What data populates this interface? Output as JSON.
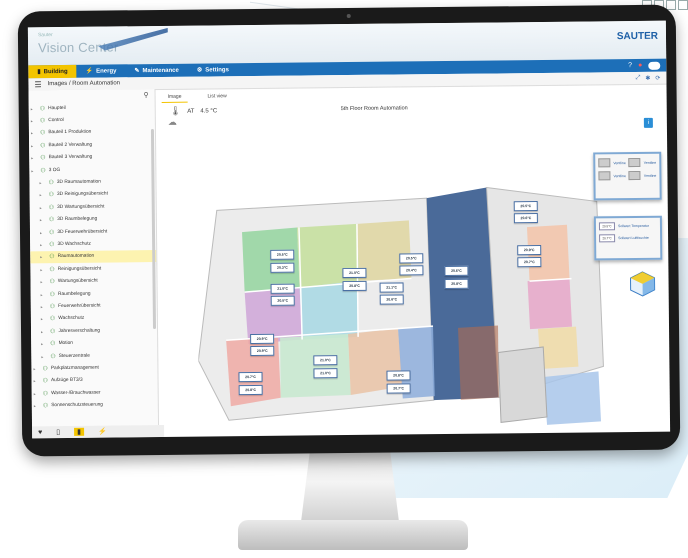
{
  "app": {
    "logo_small": "Sauter",
    "logo": "Vision Center",
    "brand": "SAUTER"
  },
  "tabs": [
    {
      "label": "Building",
      "icon": "building-icon",
      "active": true
    },
    {
      "label": "Energy",
      "icon": "lightning-icon",
      "active": false
    },
    {
      "label": "Maintenance",
      "icon": "wrench-icon",
      "active": false
    },
    {
      "label": "Settings",
      "icon": "gear-icon",
      "active": false
    }
  ],
  "breadcrumb": "Images / Room Automation",
  "tree": [
    {
      "label": "Haupteil",
      "level": 1
    },
    {
      "label": "Control",
      "level": 1
    },
    {
      "label": "Bauteil 1 Produktion",
      "level": 1
    },
    {
      "label": "Bauteil 2 Verwaltung",
      "level": 1
    },
    {
      "label": "Bauteil 3 Verwaltung",
      "level": 1
    },
    {
      "label": "3 OG",
      "level": 1
    },
    {
      "label": "3D Raumautomation",
      "level": 2
    },
    {
      "label": "3D Reinigungsübersicht",
      "level": 2
    },
    {
      "label": "3D Wartungsübersicht",
      "level": 2
    },
    {
      "label": "3D Raumbelegung",
      "level": 2
    },
    {
      "label": "3D Feuerwehrübersicht",
      "level": 2
    },
    {
      "label": "3D Wachschutz",
      "level": 2
    },
    {
      "label": "Raumautomation",
      "level": 2,
      "selected": true
    },
    {
      "label": "Reinigungsübersicht",
      "level": 2
    },
    {
      "label": "Wartungsübersicht",
      "level": 2
    },
    {
      "label": "Raumbelegung",
      "level": 2
    },
    {
      "label": "Feuerwehrübersicht",
      "level": 2
    },
    {
      "label": "Wachschutz",
      "level": 2
    },
    {
      "label": "Jahresverschaltung",
      "level": 2
    },
    {
      "label": "Motion",
      "level": 2
    },
    {
      "label": "Steuerzentrale",
      "level": 2
    },
    {
      "label": "Parkplatzmanagement",
      "level": 1
    },
    {
      "label": "Aufzüge BT3/3",
      "level": 1
    },
    {
      "label": "Wasser-/Brauchwasser",
      "level": 1
    },
    {
      "label": "Sonnenschutzsteuerung",
      "level": 1
    }
  ],
  "main": {
    "tab_image": "Image",
    "tab_list": "List view",
    "temp_label": "AT",
    "temp_value": "4.5 °C",
    "plan_title": "5th Floor Room Automation"
  },
  "room_labels": [
    "20.5°C",
    "20.3°C",
    "21.0°C",
    "20.8°C",
    "20.5°C",
    "20.4°C",
    "21.0°C",
    "20.5°C",
    "21.1°C",
    "20.6°C",
    "20.9°C",
    "20.9°C",
    "20.7°C",
    "20.8°C",
    "21.0°C",
    "21.0°C",
    "20.8°C",
    "20.7°C",
    "20.6°C",
    "20.8°C",
    "20.5°C",
    "20.6°C",
    "20.9°C",
    "20.7°C"
  ],
  "legend1": [
    {
      "a": "Ventline",
      "b": "Ventline"
    },
    {
      "a": "Ventline",
      "b": "Ventline"
    }
  ],
  "legend2": [
    {
      "val": "20.5°C",
      "label": "Sollwert Temperatur"
    },
    {
      "val": "20.7°C",
      "label": "Sollwert Luftfeuchte"
    }
  ]
}
